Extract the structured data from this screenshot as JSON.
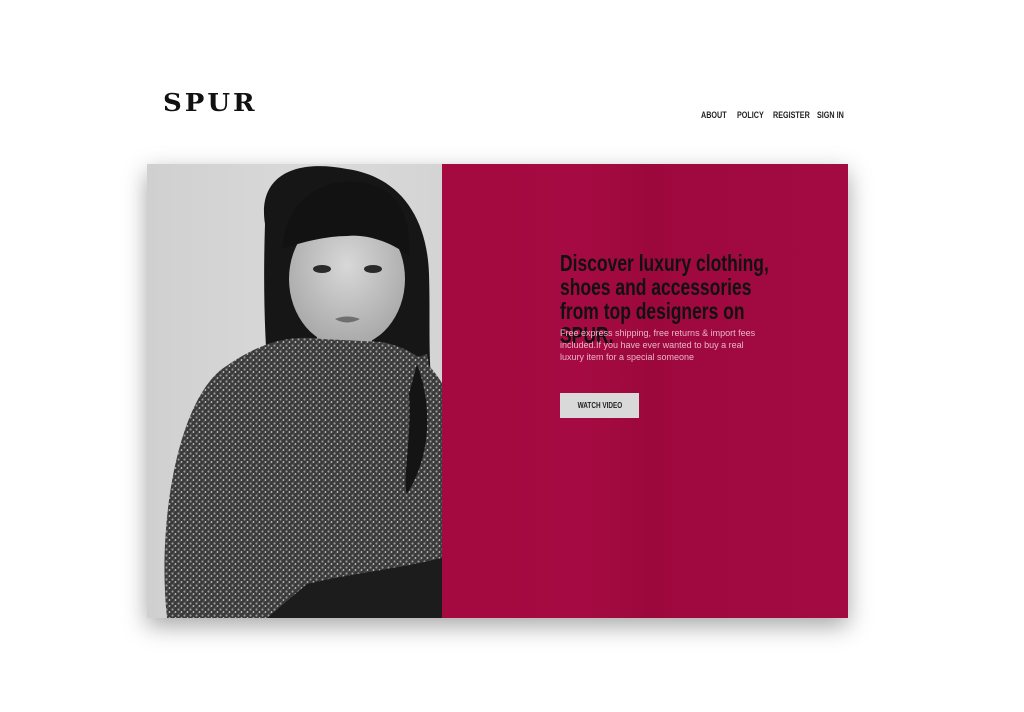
{
  "brand": {
    "logo_text": "SPUR"
  },
  "nav": {
    "items": [
      "ABOUT",
      "POLICY",
      "REGISTER",
      "SIGN IN"
    ]
  },
  "hero": {
    "headline": "Discover luxury clothing, shoes and accessories from top designers on SPUR.",
    "subtext": "Free express shipping, free returns & import fees included.If you have ever wanted to buy a real luxury item for a special someone",
    "cta_label": "WATCH VIDEO",
    "image_description_icon": "model-photo",
    "colors": {
      "panel": "#a1093f",
      "headline": "#111111",
      "subtext": "#e9b7c9",
      "button": "#d9d9d9"
    }
  }
}
